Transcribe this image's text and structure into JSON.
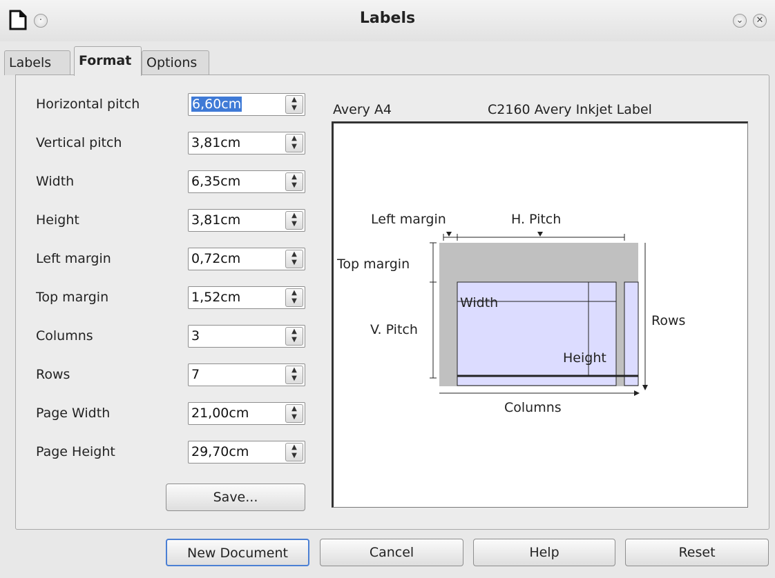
{
  "window": {
    "title": "Labels",
    "icons": [
      "document-icon",
      "menu-dot-icon",
      "minimize-icon",
      "close-icon"
    ]
  },
  "tabs": [
    {
      "label": "Labels",
      "active": false
    },
    {
      "label": "Format",
      "active": true
    },
    {
      "label": "Options",
      "active": false
    }
  ],
  "fields": [
    {
      "label": "Horizontal pitch",
      "value": "6,60cm",
      "selected": true
    },
    {
      "label": "Vertical pitch",
      "value": "3,81cm",
      "selected": false
    },
    {
      "label": "Width",
      "value": "6,35cm",
      "selected": false
    },
    {
      "label": "Height",
      "value": "3,81cm",
      "selected": false
    },
    {
      "label": "Left margin",
      "value": "0,72cm",
      "selected": false
    },
    {
      "label": "Top margin",
      "value": "1,52cm",
      "selected": false
    },
    {
      "label": "Columns",
      "value": "3",
      "selected": false
    },
    {
      "label": "Rows",
      "value": "7",
      "selected": false
    },
    {
      "label": "Page Width",
      "value": "21,00cm",
      "selected": false
    },
    {
      "label": "Page Height",
      "value": "29,70cm",
      "selected": false
    }
  ],
  "save_button": "Save...",
  "label_info": {
    "brand": "Avery A4",
    "type": "C2160 Avery Inkjet Label"
  },
  "preview": {
    "left_margin": "Left margin",
    "h_pitch": "H. Pitch",
    "top_margin": "Top margin",
    "width": "Width",
    "v_pitch": "V. Pitch",
    "rows": "Rows",
    "height": "Height",
    "columns": "Columns",
    "colors": {
      "page": "#c0c0c0",
      "label": "#dcdcff"
    }
  },
  "footer": {
    "new_document": "New Document",
    "cancel": "Cancel",
    "help": "Help",
    "reset": "Reset"
  }
}
